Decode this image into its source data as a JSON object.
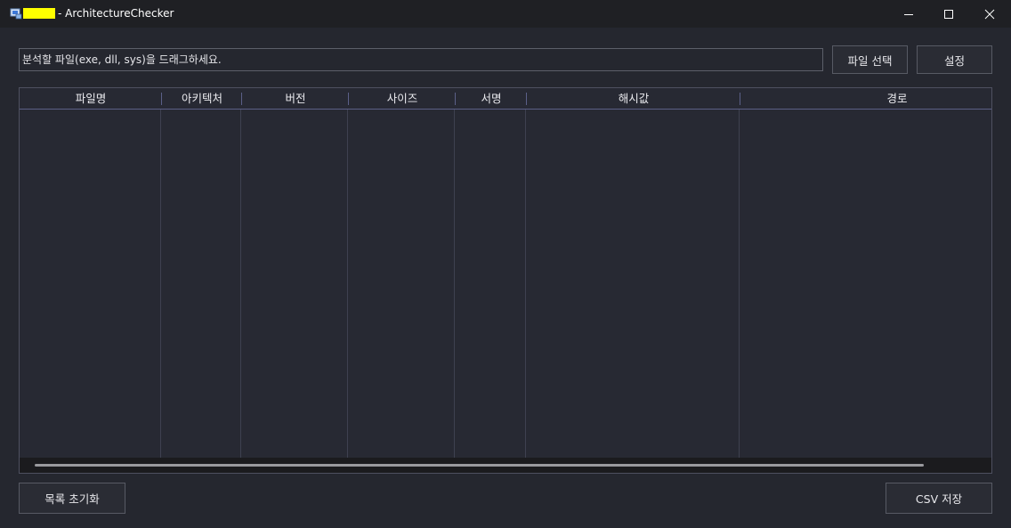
{
  "window": {
    "title": "- ArchitectureChecker",
    "controls": {
      "minimize": "minimize-icon",
      "maximize": "maximize-icon",
      "close": "close-icon"
    }
  },
  "drop_field": {
    "placeholder": "분석할 파일(exe, dll, sys)을 드래그하세요."
  },
  "toolbar": {
    "select_file": "파일 선택",
    "settings": "설정"
  },
  "table": {
    "columns": [
      "파일명",
      "아키텍처",
      "버전",
      "사이즈",
      "서명",
      "해시값",
      "경로"
    ],
    "rows": []
  },
  "footer": {
    "clear_list": "목록 초기화",
    "save_csv": "CSV 저장"
  },
  "colors": {
    "background": "#25272f",
    "titlebar": "#1f2024",
    "border": "#575a64",
    "header_line": "#5b5f86",
    "redaction": "#ffff00"
  }
}
